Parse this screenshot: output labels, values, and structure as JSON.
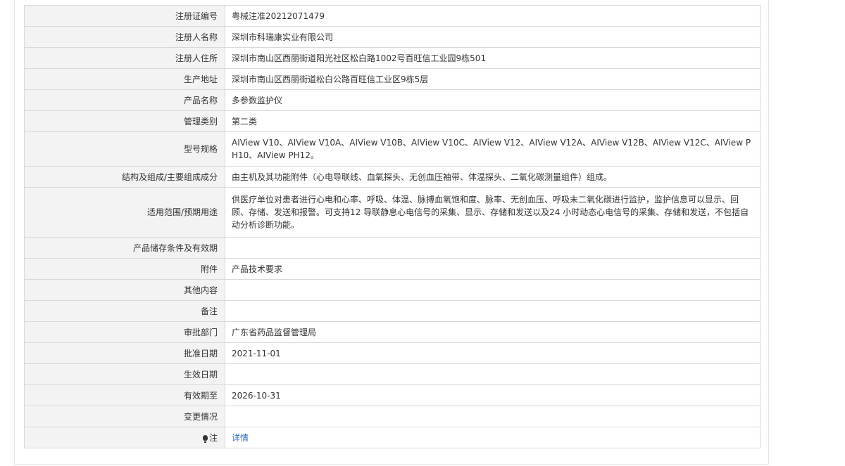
{
  "rows": [
    {
      "label": "注册证编号",
      "value": "粤械注准20212071479"
    },
    {
      "label": "注册人名称",
      "value": "深圳市科瑞康实业有限公司"
    },
    {
      "label": "注册人住所",
      "value": "深圳市南山区西丽街道阳光社区松白路1002号百旺信工业园9栋501"
    },
    {
      "label": "生产地址",
      "value": "深圳市南山区西丽街道松白公路百旺信工业区9栋5层"
    },
    {
      "label": "产品名称",
      "value": "多参数监护仪"
    },
    {
      "label": "管理类别",
      "value": "第二类"
    },
    {
      "label": "型号规格",
      "value": "AIView V10、AIView V10A、AIView V10B、AIView V10C、AIView V12、AIView V12A、AIView V12B、AIView V12C、AIView PH10、AIView PH12。"
    },
    {
      "label": "结构及组成/主要组成成分",
      "value": "由主机及其功能附件（心电导联线、血氧探头、无创血压袖带、体温探头、二氧化碳测量组件）组成。"
    },
    {
      "label": "适用范围/预期用途",
      "value": "供医疗单位对患者进行心电和心率、呼吸、体温、脉搏血氧饱和度、脉率、无创血压、呼吸末二氧化碳进行监护，监护信息可以显示、回顾、存储、发送和报警。可支持12 导联静息心电信号的采集、显示、存储和发送以及24 小时动态心电信号的采集、存储和发送，不包括自动分析诊断功能。"
    },
    {
      "label": "产品储存条件及有效期",
      "value": ""
    },
    {
      "label": "附件",
      "value": "产品技术要求"
    },
    {
      "label": "其他内容",
      "value": ""
    },
    {
      "label": "备注",
      "value": ""
    },
    {
      "label": "审批部门",
      "value": "广东省药品监督管理局"
    },
    {
      "label": "批准日期",
      "value": "2021-11-01"
    },
    {
      "label": "生效日期",
      "value": ""
    },
    {
      "label": "有效期至",
      "value": "2026-10-31"
    },
    {
      "label": "变更情况",
      "value": ""
    }
  ],
  "note": {
    "label": "注",
    "icon": "bulb-icon",
    "link_text": "详情",
    "link_color": "#2a6fc9"
  }
}
